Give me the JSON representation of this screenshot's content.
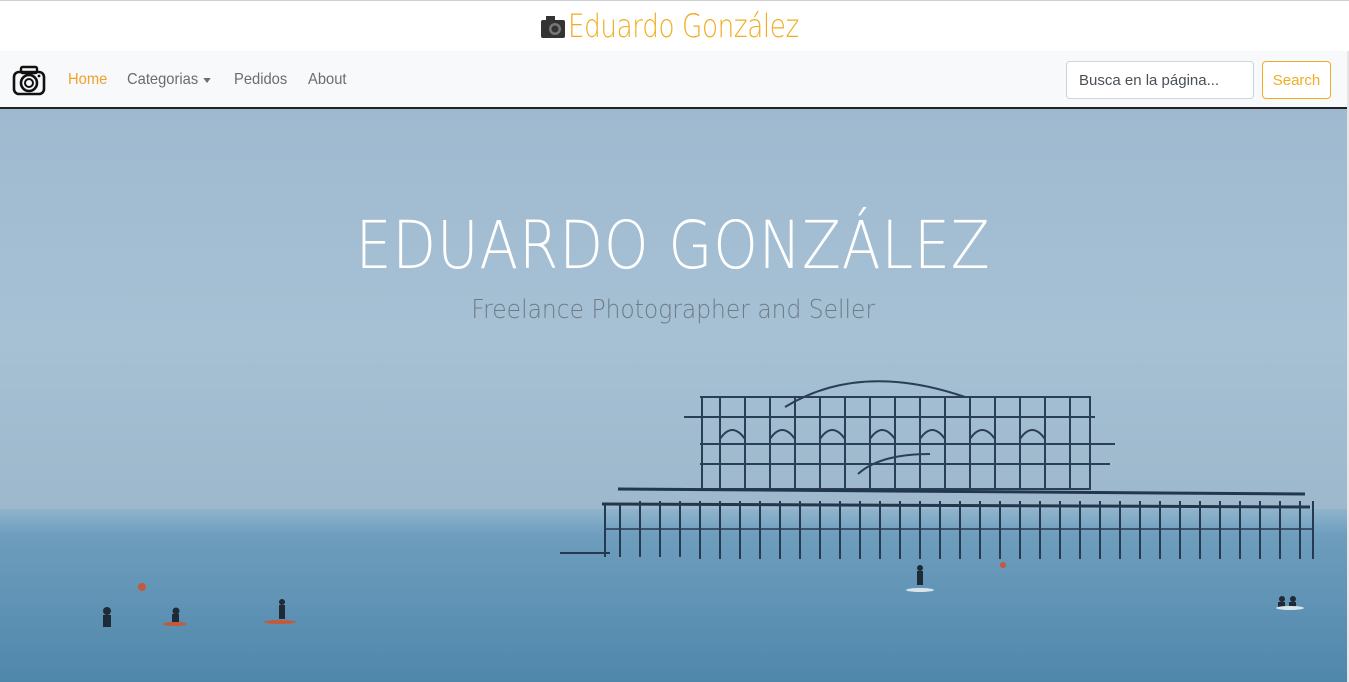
{
  "header": {
    "brand_title": "Eduardo González"
  },
  "nav": {
    "items": [
      {
        "label": "Home",
        "active": true
      },
      {
        "label": "Categorias",
        "dropdown": true
      },
      {
        "label": "Pedidos"
      },
      {
        "label": "About"
      }
    ],
    "search": {
      "placeholder": "Busca en la página...",
      "button_label": "Search"
    }
  },
  "hero": {
    "title": "EDUARDO GONZÁLEZ",
    "subtitle": "Freelance Photographer and Seller"
  },
  "colors": {
    "accent": "#f0ad23",
    "navbar_bg": "#f8f9fa",
    "sky": "#a6c0d4",
    "sea": "#5a8eb0"
  },
  "icons": {
    "brand": "camera-icon",
    "nav_logo": "camera-icon"
  }
}
